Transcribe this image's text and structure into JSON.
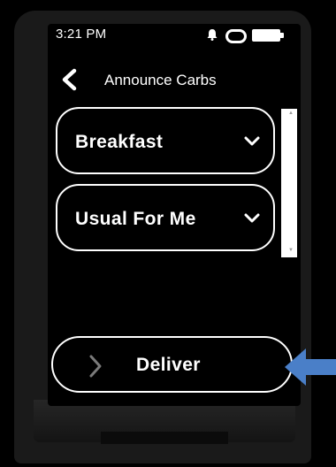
{
  "status": {
    "time": "3:21 PM"
  },
  "header": {
    "title": "Announce Carbs"
  },
  "dropdowns": [
    {
      "label": "Breakfast"
    },
    {
      "label": "Usual For Me"
    }
  ],
  "actions": {
    "deliver_label": "Deliver"
  },
  "colors": {
    "background": "#000000",
    "foreground": "#ffffff",
    "annotation_arrow": "#4a7fc8"
  }
}
